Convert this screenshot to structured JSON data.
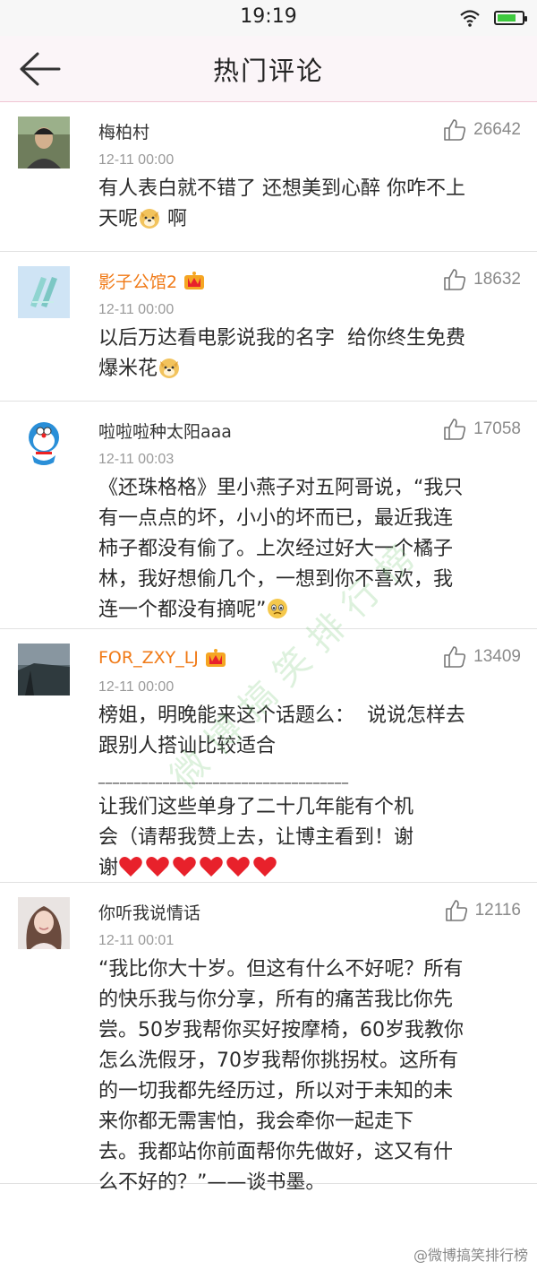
{
  "status_bar": {
    "time": "19:19",
    "battery_level": 0.75,
    "battery_color": "#3ec93e"
  },
  "nav": {
    "title": "热门评论",
    "back_icon": "back-arrow-icon"
  },
  "comments": [
    {
      "author": "梅柏村",
      "vip": false,
      "likes": "26642",
      "time": "12-11 00:00",
      "lines": [
        "有人表白就不错了 还想美到心醉 你咋不上",
        "天呢",
        " 啊"
      ],
      "emoji": "doge-emoji"
    },
    {
      "author": "影子公馆2",
      "vip": true,
      "likes": "18632",
      "time": "12-11 00:00",
      "lines": [
        "以后万达看电影说我的名字  给你终生免费",
        "爆米花"
      ],
      "emoji": "doge-emoji"
    },
    {
      "author": "啦啦啦种太阳aaa",
      "vip": false,
      "likes": "17058",
      "time": "12-11 00:03",
      "lines": [
        "《还珠格格》里小燕子对五阿哥说，“我只",
        "有一点点的坏，小小的坏而已，最近我连",
        "柿子都没有偷了。上次经过好大一个橘子",
        "林，我好想偷几个，一想到你不喜欢，我",
        "连一个都没有摘呢”"
      ],
      "emoji": "sad-emoji"
    },
    {
      "author": "FOR_ZXY_LJ",
      "vip": true,
      "likes": "13409",
      "time": "12-11 00:00",
      "lines": [
        "榜姐，明晚能来这个话题么：  说说怎样去",
        "跟别人搭讪比较适合",
        "___________________________________",
        "让我们这些单身了二十几年能有个机",
        "会（请帮我赞上去，让博主看到！谢",
        "谢"
      ],
      "hearts": 6,
      "heart_color": "#e8212b"
    },
    {
      "author": "你听我说情话",
      "vip": false,
      "likes": "12116",
      "time": "12-11 00:01",
      "lines": [
        "“我比你大十岁。但这有什么不好呢？所有",
        "的快乐我与你分享，所有的痛苦我比你先",
        "尝。50岁我帮你买好按摩椅，60岁我教你",
        "怎么洗假牙，70岁我帮你挑拐杖。这所有",
        "的一切我都先经历过，所以对于未知的未",
        "来你都无需害怕，我会牵你一起走下",
        "去。我都站你前面帮你先做好，这又有什",
        "么不好的？”——谈书墨。"
      ]
    }
  ],
  "watermark": "微博搞笑排行榜",
  "footer_mark": "@微博搞笑排行榜",
  "colors": {
    "vip_name": "#f07a17",
    "nav_bg": "#fbf5f8",
    "like_count": "#8a8a8a"
  }
}
